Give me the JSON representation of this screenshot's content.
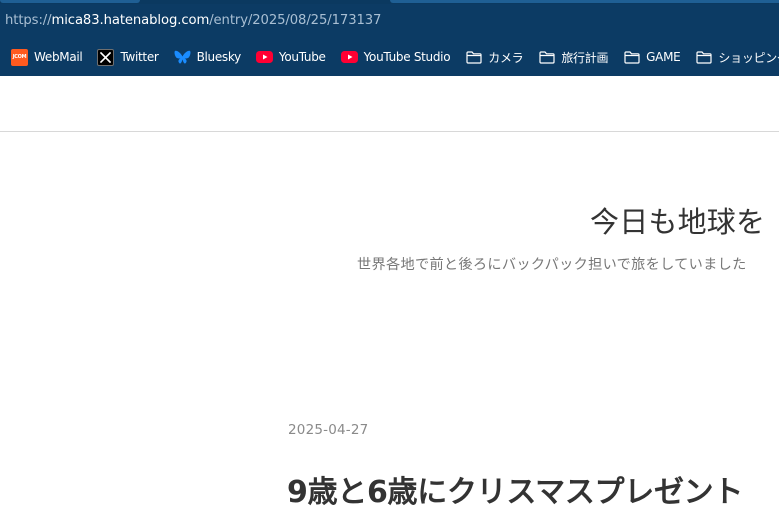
{
  "browser": {
    "url": {
      "scheme": "https://",
      "host": "mica83.hatenablog.com",
      "path": "/entry/2025/08/25/173137"
    },
    "theme_color": "#0c3b64",
    "bookmarks": [
      {
        "label": "WebMail",
        "icon": "webmail-icon",
        "icon_text": "JCOM"
      },
      {
        "label": "Twitter",
        "icon": "x-logo-icon"
      },
      {
        "label": "Bluesky",
        "icon": "butterfly-icon"
      },
      {
        "label": "YouTube",
        "icon": "youtube-icon"
      },
      {
        "label": "YouTube Studio",
        "icon": "youtube-icon"
      },
      {
        "label": "カメラ",
        "icon": "folder-icon"
      },
      {
        "label": "旅行計画",
        "icon": "folder-icon"
      },
      {
        "label": "GAME",
        "icon": "folder-icon"
      },
      {
        "label": "ショッピング",
        "icon": "folder-icon"
      }
    ]
  },
  "blog": {
    "title": "今日も地球を",
    "description": "世界各地で前と後ろにバックパック担いで旅をしていました"
  },
  "entry": {
    "date": "2025-04-27",
    "title": "9歳と6歳にクリスマスプレゼント"
  }
}
